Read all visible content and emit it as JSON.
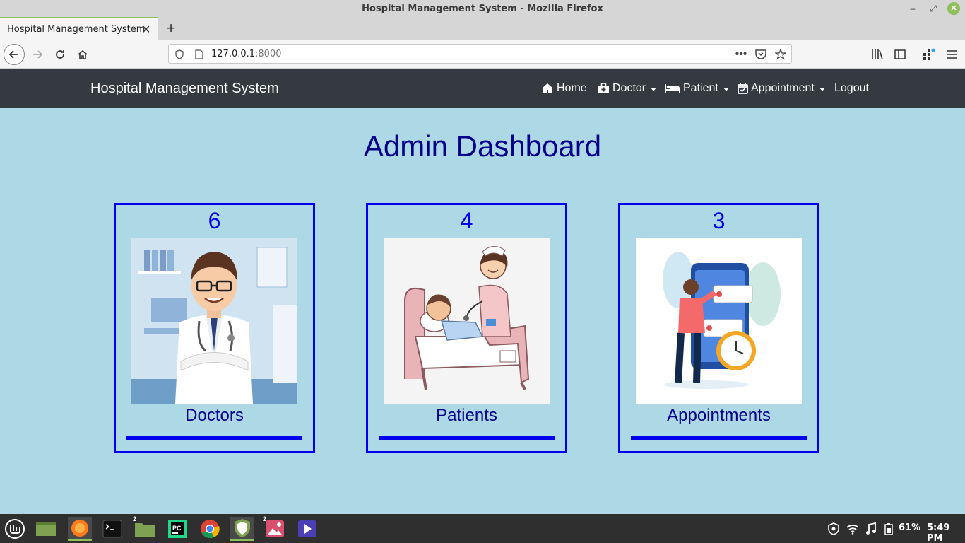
{
  "window": {
    "title": "Hospital Management System - Mozilla Firefox",
    "tab_title": "Hospital Management System",
    "url_host": "127.0.0.1",
    "url_port": ":8000"
  },
  "nav": {
    "brand": "Hospital Management System",
    "home": "Home",
    "doctor": "Doctor",
    "patient": "Patient",
    "appointment": "Appointment",
    "logout": "Logout"
  },
  "page": {
    "heading": "Admin Dashboard"
  },
  "cards": [
    {
      "count": "6",
      "label": "Doctors",
      "image": "doctor-illustration"
    },
    {
      "count": "4",
      "label": "Patients",
      "image": "nurse-patient-illustration"
    },
    {
      "count": "3",
      "label": "Appointments",
      "image": "appointment-illustration"
    }
  ],
  "taskbar": {
    "files_badge": "2",
    "images_badge": "2",
    "battery": "61%",
    "clock": "5:49 PM"
  },
  "colors": {
    "background": "#add8e6",
    "navbar": "#343a40",
    "accent": "#0000ee",
    "heading": "#00008b"
  }
}
